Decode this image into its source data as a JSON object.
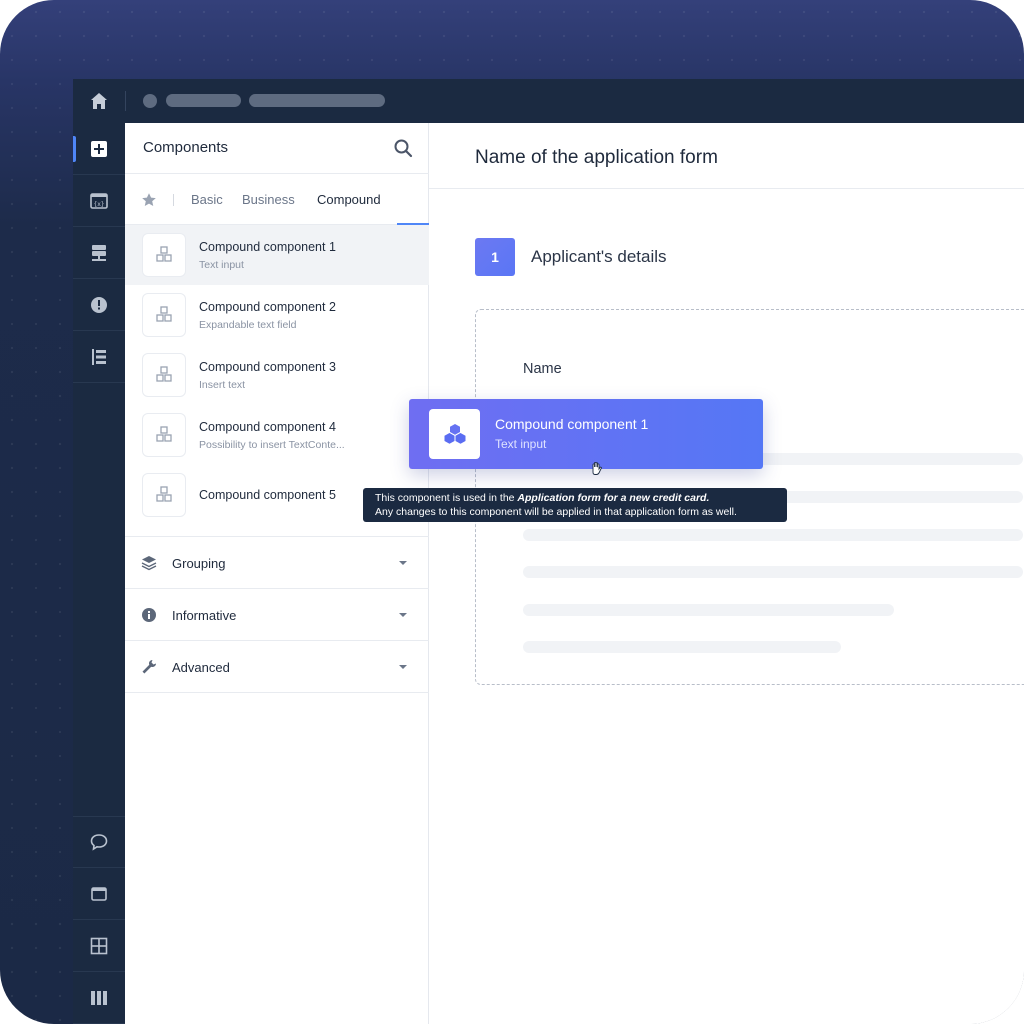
{
  "sidebar_panel": {
    "title": "Components",
    "tabs": [
      "Basic",
      "Business",
      "Compound"
    ],
    "active_tab": "Compound",
    "components": [
      {
        "name": "Compound component 1",
        "subtitle": "Text input"
      },
      {
        "name": "Compound component 2",
        "subtitle": "Expandable text field"
      },
      {
        "name": "Compound component 3",
        "subtitle": "Insert text"
      },
      {
        "name": "Compound component 4",
        "subtitle": "Possibility to insert TextConte..."
      },
      {
        "name": "Compound component 5",
        "subtitle": ""
      }
    ],
    "groups": [
      {
        "label": "Grouping",
        "icon": "layers-icon"
      },
      {
        "label": "Informative",
        "icon": "info-icon"
      },
      {
        "label": "Advanced",
        "icon": "wrench-icon"
      }
    ]
  },
  "rail": {
    "top_icons": [
      "add-square-icon",
      "window-code-icon",
      "database-network-icon",
      "alert-circle-icon",
      "list-tree-icon"
    ],
    "bottom_icons": [
      "chat-bubble-icon",
      "browser-window-icon",
      "grid-icon",
      "columns-icon"
    ]
  },
  "main": {
    "form_title": "Name of the application form",
    "step_number": "1",
    "step_title": "Applicant's details",
    "field_label": "Name"
  },
  "drag_card": {
    "name": "Compound component 1",
    "subtitle": "Text input"
  },
  "tooltip": {
    "line1_prefix": "This component is used in the ",
    "line1_emphasis": "Application form for a new credit card.",
    "line2": "Any changes to this component will be applied in that application form as well."
  },
  "colors": {
    "accent": "#4f86f7",
    "drag_gradient_start": "#6f6ef2",
    "drag_gradient_end": "#5577f5",
    "dark_nav": "#1b2a41"
  }
}
